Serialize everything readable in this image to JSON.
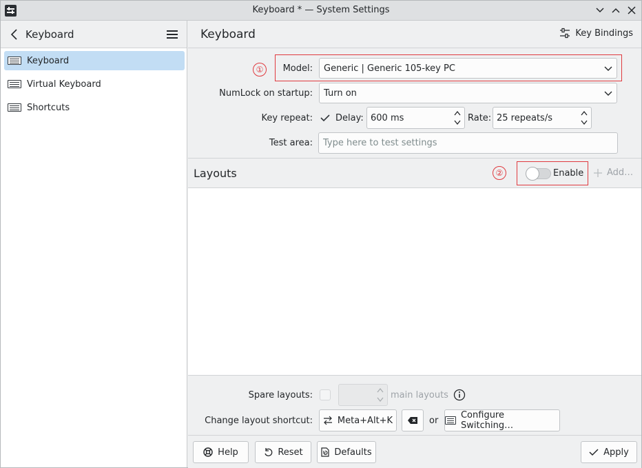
{
  "window": {
    "title": "Keyboard * — System Settings"
  },
  "sidebar": {
    "header_title": "Keyboard",
    "items": [
      {
        "label": "Keyboard",
        "icon": "keyboard-icon",
        "selected": true
      },
      {
        "label": "Virtual Keyboard",
        "icon": "keyboard-icon",
        "selected": false
      },
      {
        "label": "Shortcuts",
        "icon": "keyboard-icon",
        "selected": false
      }
    ]
  },
  "main": {
    "title": "Keyboard",
    "key_bindings_label": "Key Bindings"
  },
  "form": {
    "model_label": "Model:",
    "model_value": "Generic | Generic 105-key PC",
    "numlock_label": "NumLock on startup:",
    "numlock_value": "Turn on",
    "key_repeat_label": "Key repeat:",
    "key_repeat_checked": true,
    "delay_label": "Delay:",
    "delay_value": "600 ms",
    "rate_label": "Rate:",
    "rate_value": "25 repeats/s",
    "test_area_label": "Test area:",
    "test_area_placeholder": "Type here to test settings"
  },
  "annotations": {
    "one": "①",
    "two": "②"
  },
  "layouts": {
    "title": "Layouts",
    "enable_label": "Enable",
    "enable_on": false,
    "add_label": "Add…",
    "spare_layouts_label": "Spare layouts:",
    "spare_suffix": "main layouts",
    "change_shortcut_label": "Change layout shortcut:",
    "shortcut_value": "Meta+Alt+K",
    "or_label": "or",
    "configure_switching_label": "Configure Switching…"
  },
  "footer": {
    "help_label": "Help",
    "reset_label": "Reset",
    "defaults_label": "Defaults",
    "apply_label": "Apply"
  },
  "colors": {
    "accent": "#3daee9",
    "selection": "#c2ddf4",
    "annotation": "#e0393e"
  }
}
